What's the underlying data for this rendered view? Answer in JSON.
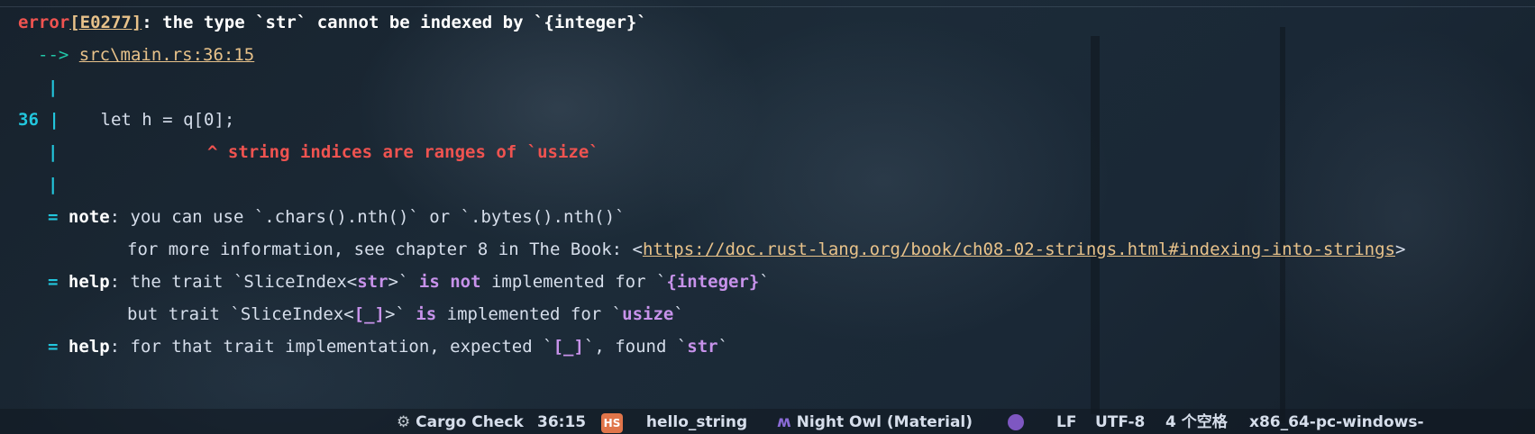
{
  "error": {
    "prefix": "error",
    "code": "[E0277]",
    "message": ": the type `str` cannot be indexed by `{integer}`",
    "arrow": "-->",
    "location": "src\\main.rs:36:15"
  },
  "code_line": {
    "number": "36",
    "code": "    let h = q[0];"
  },
  "caret_line": {
    "caret": "^",
    "message": "string indices are ranges of `usize`"
  },
  "note": {
    "eq": "=",
    "label": "note",
    "text1": ": you can use `.chars().nth()` or `.bytes().nth()`",
    "text2_pre": "for more information, see chapter 8 in The Book: <",
    "url": "https://doc.rust-lang.org/book/ch08-02-strings.html#indexing-into-strings",
    "text2_post": ">"
  },
  "help1": {
    "eq": "=",
    "label": "help",
    "a": ": the trait `SliceIndex<",
    "b": "str",
    "c": ">` ",
    "d": "is not",
    "e": " implemented for `",
    "f": "{integer}",
    "g": "`"
  },
  "help1_cont": {
    "a": "but trait `SliceIndex<",
    "b": "[_]",
    "c": ">` ",
    "d": "is",
    "e": " implemented for `",
    "f": "usize",
    "g": "`"
  },
  "help2": {
    "eq": "=",
    "label": "help",
    "a": ": for that trait implementation, expected `",
    "b": "[_]",
    "c": "`, found `",
    "d": "str",
    "e": "`"
  },
  "gutter_bar": "|",
  "status_bar": {
    "cargo_check": "Cargo Check",
    "position": "36:15",
    "hs_badge": "HS",
    "project": "hello_string",
    "theme": "Night Owl (Material)",
    "line_ending": "LF",
    "encoding": "UTF-8",
    "indent": "4 个空格",
    "target": "x86_64-pc-windows-"
  },
  "colors": {
    "error": "#ef5350",
    "accent_cyan": "#22c6dd",
    "link": "#e8c28a",
    "keyword": "#c792ea",
    "text": "#d6deeb"
  }
}
